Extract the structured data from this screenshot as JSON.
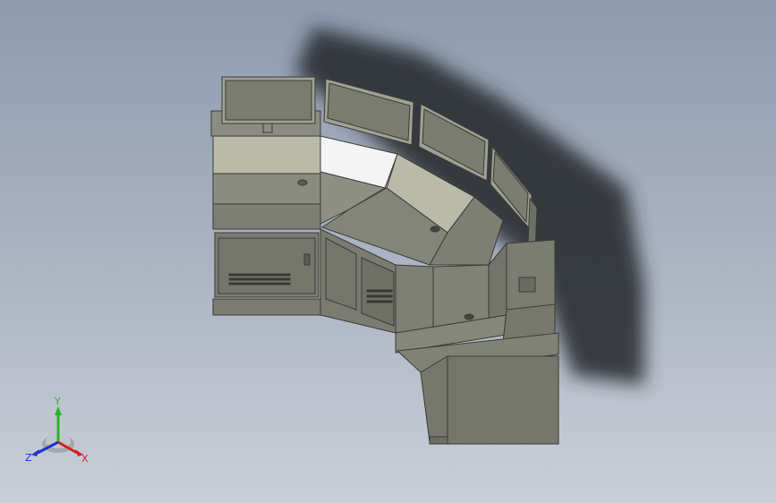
{
  "triad": {
    "x_label": "X",
    "y_label": "Y",
    "z_label": "Z",
    "x_color": "#d22020",
    "y_color": "#28b428",
    "z_color": "#2030d8"
  },
  "model": {
    "shadow_color": "#2b2e33",
    "body_color": "#7c7e73",
    "panel_light": "#b9baa8",
    "screen_color": "#7a7c70",
    "highlight": "#f4f4f4"
  }
}
